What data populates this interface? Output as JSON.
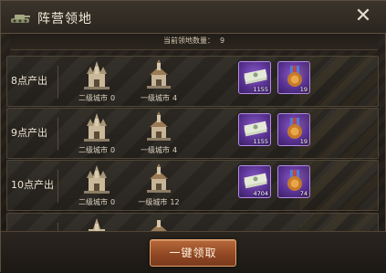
{
  "window": {
    "title": "阵营领地",
    "close_glyph": "✕"
  },
  "summary": {
    "label": "当前领地数量：",
    "value": "9"
  },
  "rows": [
    {
      "label": "8点产出",
      "city_a": {
        "label": "二级城市",
        "count": "0"
      },
      "city_b": {
        "label": "一级城市",
        "count": "4"
      },
      "cash": "1155",
      "medal": "19"
    },
    {
      "label": "9点产出",
      "city_a": {
        "label": "二级城市",
        "count": "0"
      },
      "city_b": {
        "label": "一级城市",
        "count": "4"
      },
      "cash": "1155",
      "medal": "19"
    },
    {
      "label": "10点产出",
      "city_a": {
        "label": "二级城市",
        "count": "0"
      },
      "city_b": {
        "label": "一级城市",
        "count": "12"
      },
      "cash": "4704",
      "medal": "74"
    },
    {
      "label": "",
      "city_a": {
        "label": "",
        "count": ""
      },
      "city_b": {
        "label": "",
        "count": ""
      },
      "cash": "",
      "medal": ""
    }
  ],
  "actions": {
    "claim_all": "一键领取"
  },
  "icons": {
    "title": "tank-icon",
    "close": "close-icon",
    "level2_city": "cathedral-icon",
    "level1_city": "church-icon",
    "cash_reward": "cash-stack-icon",
    "medal_reward": "medal-box-icon"
  },
  "colors": {
    "reward_frame": "#5b3494",
    "claim_button": "#8f4624",
    "panel_bg": "#27221c"
  }
}
